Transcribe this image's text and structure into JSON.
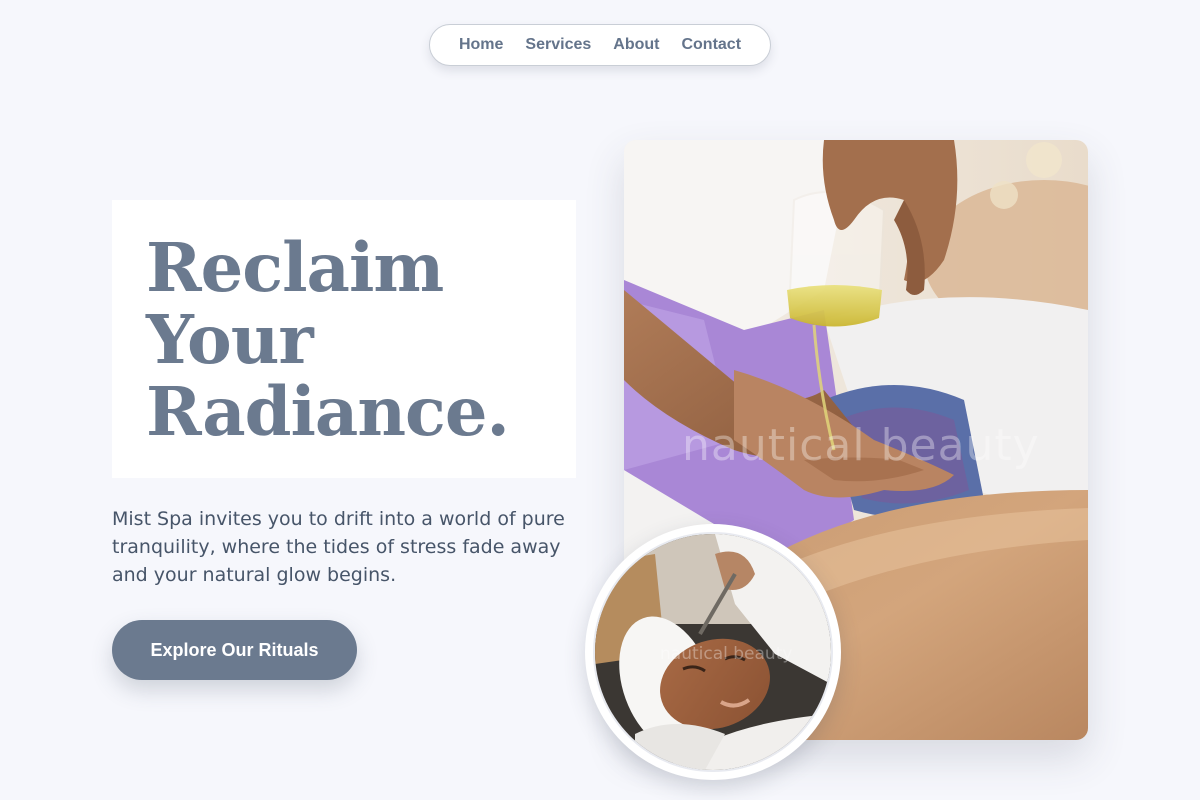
{
  "nav": {
    "items": [
      {
        "label": "Home"
      },
      {
        "label": "Services"
      },
      {
        "label": "About"
      },
      {
        "label": "Contact"
      }
    ]
  },
  "hero": {
    "headline_line1": "Reclaim",
    "headline_line2": "Your",
    "headline_line3": "Radiance.",
    "intro": "Mist Spa invites you to drift into a world of pure tranquility, where the tides of stress fade away and your natural glow begins.",
    "cta_label": "Explore Our Rituals"
  },
  "media": {
    "main_photo_alt": "oil poured onto hand during massage",
    "main_watermark": "nautical beauty",
    "circle_photo_alt": "woman receiving facial mask treatment",
    "circle_watermark": "nautical beauty"
  },
  "colors": {
    "background": "#f6f7fc",
    "accent": "#6b7a8f",
    "text": "#475569",
    "nav_text": "#64748b"
  }
}
